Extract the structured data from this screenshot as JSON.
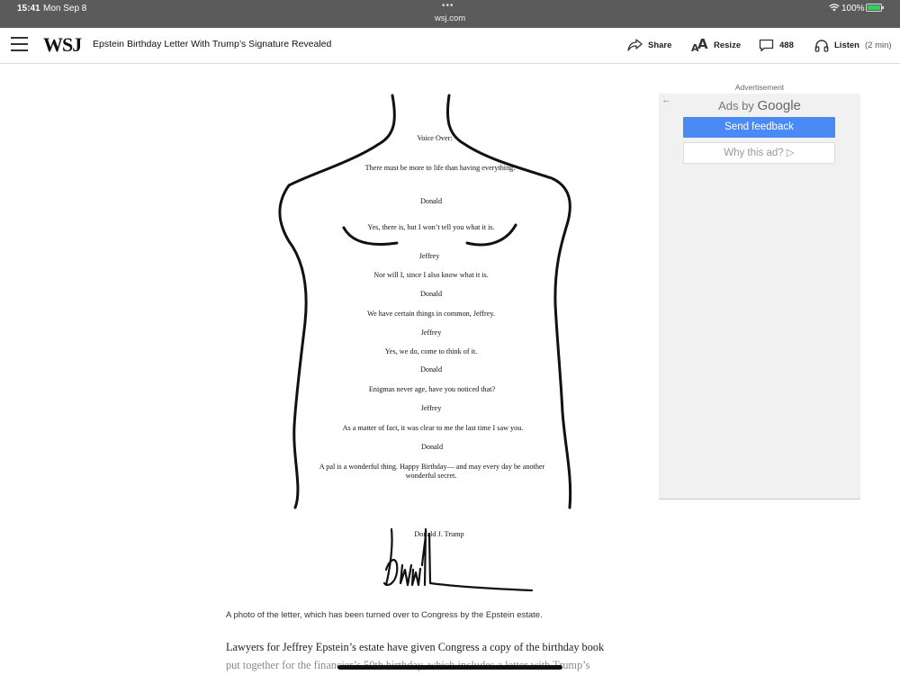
{
  "status_bar": {
    "time": "15:41",
    "date": "Mon Sep 8",
    "url": "wsj.com",
    "battery": "100%"
  },
  "header": {
    "logo": "WSJ",
    "headline": "Epstein Birthday Letter With Trump’s Signature Revealed",
    "share_label": "Share",
    "resize_label": "Resize",
    "comment_count": "488",
    "listen_label": "Listen",
    "listen_duration": "(2 min)"
  },
  "letter": {
    "lines": [
      "Voice Over:",
      "There must be more to life than having everything.",
      "Donald",
      "Yes, there is, but I won’t tell you what it is.",
      "Jeffrey",
      "Nor will I, since I also know what it is.",
      "Donald",
      "We have certain things in common, Jeffrey.",
      "Jeffrey",
      "Yes, we do, come to think of it.",
      "Donald",
      "Enigmas never age, have you noticed that?",
      "Jeffrey",
      "As a matter of fact, it was clear to me the last time I saw you.",
      "Donald",
      "A pal is a wonderful thing. Happy Birthday— and may every day be another",
      "wonderful secret."
    ],
    "signature_name": "Donald J. Trump"
  },
  "article": {
    "caption": "A photo of the letter, which has been turned over to Congress by the Epstein estate.",
    "body_line1": "Lawyers for Jeffrey Epstein’s estate have given Congress a copy of the birthday book",
    "body_line2": "put together for the financier’s 50th birthday, which includes a letter with Trump’s"
  },
  "ad": {
    "label": "Advertisement",
    "ads_by": "Ads by",
    "google": "Google",
    "send_feedback": "Send feedback",
    "why_this_ad": "Why this ad? ▷"
  }
}
